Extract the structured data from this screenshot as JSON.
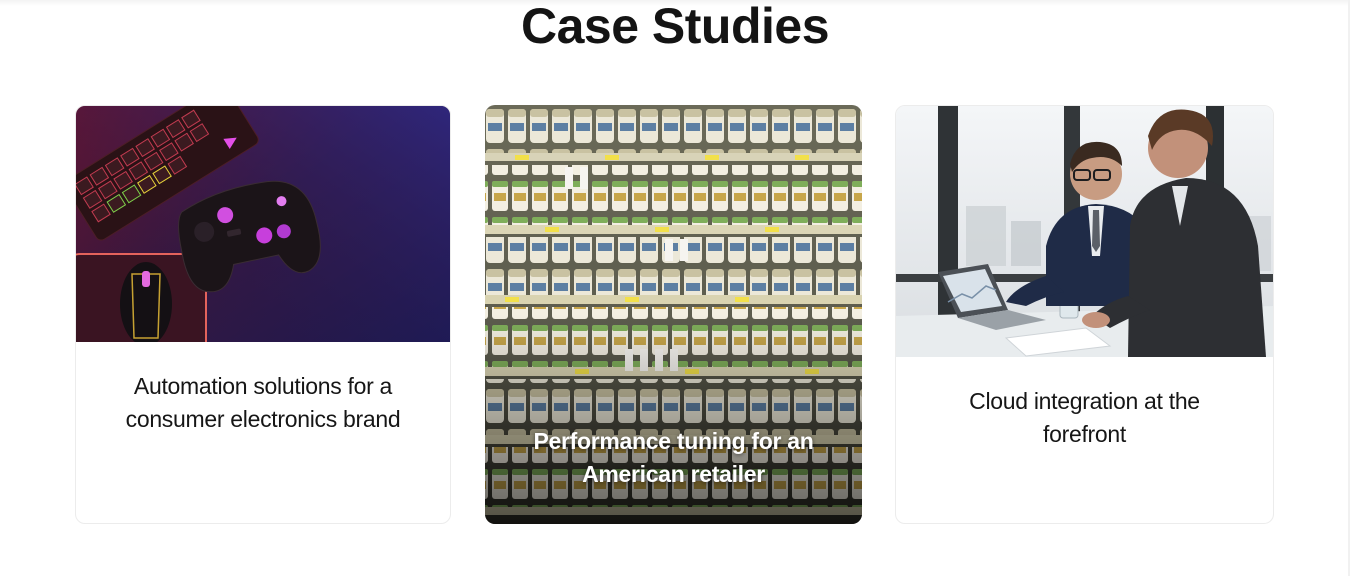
{
  "section": {
    "title": "Case Studies"
  },
  "cards": [
    {
      "caption": "Automation solutions for a consumer electronics brand",
      "image_subject": "gaming-peripherals-photo"
    },
    {
      "caption": "Performance tuning for an American retailer",
      "image_subject": "supermarket-shelves-photo"
    },
    {
      "caption": "Cloud integration at the forefront",
      "image_subject": "business-meeting-photo"
    }
  ],
  "colors": {
    "title": "#141414",
    "caption": "#161616",
    "card_border": "#ececec",
    "overlay_caption": "#ffffff"
  }
}
